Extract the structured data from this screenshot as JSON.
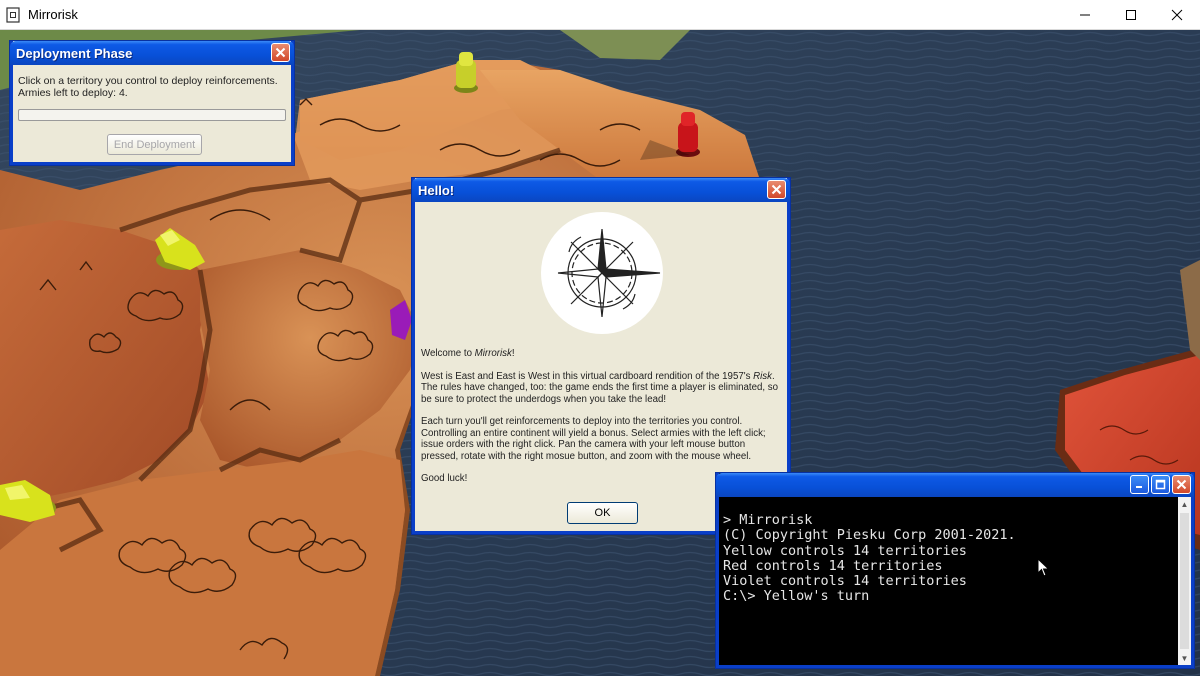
{
  "app": {
    "title": "Mirrorisk"
  },
  "deployment": {
    "title": "Deployment Phase",
    "instruction": "Click on a territory you control to deploy reinforcements.",
    "armies_left": "Armies left to deploy: 4.",
    "button_label": "End Deployment"
  },
  "hello": {
    "title": "Hello!",
    "welcome_prefix": "Welcome to ",
    "welcome_name": "Mirrorisk",
    "welcome_suffix": "!",
    "para1_a": "West is East and East is West in this virtual cardboard rendition of the 1957's ",
    "para1_italic": "Risk",
    "para1_b": ". The rules have changed, too: the game ends the first time a player is eliminated, so be sure to protect the underdogs when you take the lead!",
    "para2": "Each turn you'll get reinforcements to deploy into the territories you control. Controlling an entire continent will yield a bonus. Select armies with the left click; issue orders with the right click. Pan the camera with your left mouse button pressed, rotate with the right mosue button, and zoom with the mouse wheel.",
    "para3": "Good luck!",
    "ok_label": "OK",
    "logo_icon": "compass-rose-icon"
  },
  "console": {
    "lines": [
      "> Mirrorisk",
      "(C) Copyright Piesku Corp 2001-2021.",
      "",
      "Yellow controls 14 territories",
      "Red controls 14 territories",
      "Violet controls 14 territories",
      "C:\\> Yellow's turn"
    ]
  },
  "colors": {
    "xp_blue": "#0a46c0",
    "yellow_player": "#d8e21c",
    "red_player": "#c8141a",
    "violet_player": "#9a1bb8",
    "sea": "#2b3e57",
    "land": "#c9763e"
  }
}
